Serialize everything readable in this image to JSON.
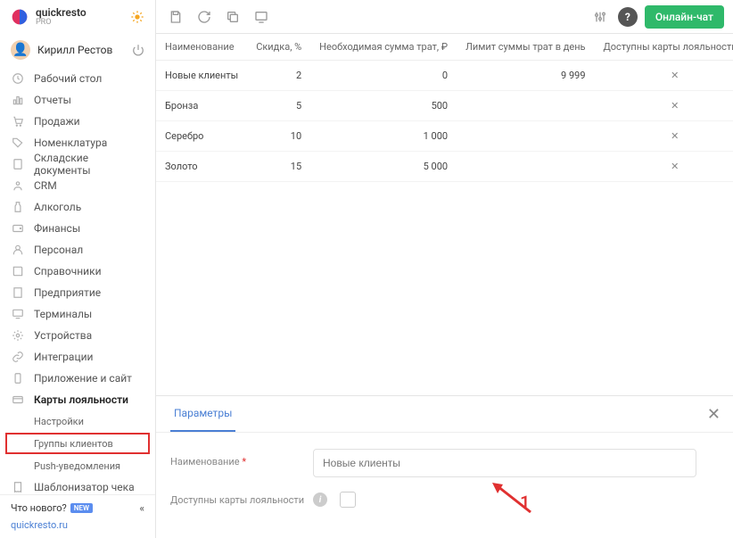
{
  "brand": {
    "name": "quickresto",
    "sub": "PRO"
  },
  "user": {
    "name": "Кирилл Рестов"
  },
  "nav": {
    "items": [
      {
        "label": "Рабочий стол"
      },
      {
        "label": "Отчеты"
      },
      {
        "label": "Продажи"
      },
      {
        "label": "Номенклатура"
      },
      {
        "label": "Складские документы"
      },
      {
        "label": "CRM"
      },
      {
        "label": "Алкоголь"
      },
      {
        "label": "Финансы"
      },
      {
        "label": "Персонал"
      },
      {
        "label": "Справочники"
      },
      {
        "label": "Предприятие"
      },
      {
        "label": "Терминалы"
      },
      {
        "label": "Устройства"
      },
      {
        "label": "Интеграции"
      },
      {
        "label": "Приложение и сайт"
      },
      {
        "label": "Карты лояльности"
      },
      {
        "label": "Шаблонизатор чека"
      }
    ],
    "subs": [
      {
        "label": "Настройки"
      },
      {
        "label": "Группы клиентов"
      },
      {
        "label": "Push-уведомления"
      }
    ]
  },
  "footer": {
    "whatsnew": "Что нового?",
    "newBadge": "NEW",
    "collapse": "«",
    "link": "quickresto.ru"
  },
  "toolbar": {
    "help": "?",
    "chat": "Онлайн-чат"
  },
  "table": {
    "headers": {
      "name": "Наименование",
      "discount": "Скидка, %",
      "neededSum": "Необходимая сумма трат, ₽",
      "limit": "Лимит суммы трат в день",
      "cards": "Доступны карты лояльности"
    },
    "rows": [
      {
        "name": "Новые клиенты",
        "discount": "2",
        "neededSum": "0",
        "limit": "9 999",
        "cards": "x"
      },
      {
        "name": "Бронза",
        "discount": "5",
        "neededSum": "500",
        "limit": "",
        "cards": "x"
      },
      {
        "name": "Серебро",
        "discount": "10",
        "neededSum": "1 000",
        "limit": "",
        "cards": "x"
      },
      {
        "name": "Золото",
        "discount": "15",
        "neededSum": "5 000",
        "limit": "",
        "cards": "x"
      }
    ],
    "more": "•••"
  },
  "panel": {
    "tab": "Параметры",
    "fields": {
      "name": {
        "label": "Наименование",
        "placeholder": "Новые клиенты"
      },
      "cards": {
        "label": "Доступны карты лояльности"
      }
    }
  },
  "annotation": {
    "text": "1"
  }
}
